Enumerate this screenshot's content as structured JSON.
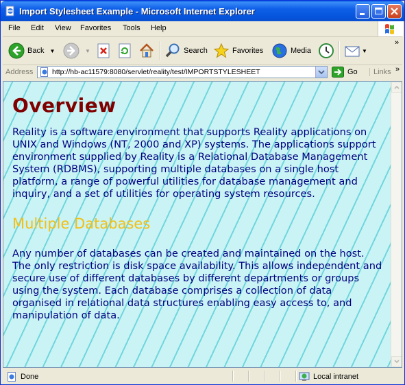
{
  "window": {
    "title": "Import Stylesheet Example - Microsoft Internet Explorer",
    "icon": "ie-page-icon"
  },
  "menu": {
    "items": [
      "File",
      "Edit",
      "View",
      "Favorites",
      "Tools",
      "Help"
    ]
  },
  "toolbar": {
    "back_label": "Back",
    "search_label": "Search",
    "favorites_label": "Favorites",
    "media_label": "Media",
    "chevron": "»"
  },
  "address": {
    "label": "Address",
    "url": "http://hb-ac11579:8080/servlet/reality/test/IMPORTSTYLESHEET",
    "go_label": "Go",
    "links_label": "Links",
    "links_chevron": "»"
  },
  "page": {
    "heading": "Overview",
    "paragraph1": "Reality is a software environment that supports Reality applications on UNIX and Windows (NT, 2000 and XP) systems. The applications support environment supplied by Reality is a Relational Database Management System (RDBMS), supporting multiple databases on a single host platform, a range of powerful utilities for database management and inquiry, and a set of utilities for operating system resources.",
    "subheading": "Multiple Databases",
    "paragraph2": "Any number of databases can be created and maintained on the host. The only restriction is disk space availability. This allows independent and secure use of different databases by different departments or groups using the system. Each database comprises a collection of data organised in relational data structures enabling easy access to, and manipulation of data."
  },
  "status": {
    "text": "Done",
    "zone": "Local intranet"
  },
  "colors": {
    "heading": "#800000",
    "body_text": "#000080",
    "subheading": "#f3bf12",
    "background": "#c9f3f5"
  }
}
